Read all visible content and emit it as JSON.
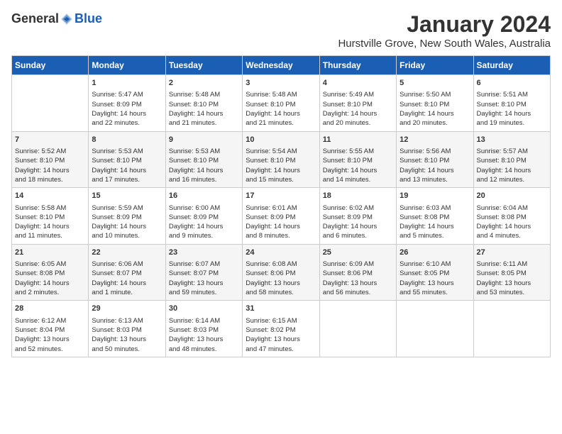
{
  "header": {
    "logo_general": "General",
    "logo_blue": "Blue",
    "title": "January 2024",
    "subtitle": "Hurstville Grove, New South Wales, Australia"
  },
  "columns": [
    "Sunday",
    "Monday",
    "Tuesday",
    "Wednesday",
    "Thursday",
    "Friday",
    "Saturday"
  ],
  "weeks": [
    [
      {
        "day": "",
        "info": ""
      },
      {
        "day": "1",
        "info": "Sunrise: 5:47 AM\nSunset: 8:09 PM\nDaylight: 14 hours\nand 22 minutes."
      },
      {
        "day": "2",
        "info": "Sunrise: 5:48 AM\nSunset: 8:10 PM\nDaylight: 14 hours\nand 21 minutes."
      },
      {
        "day": "3",
        "info": "Sunrise: 5:48 AM\nSunset: 8:10 PM\nDaylight: 14 hours\nand 21 minutes."
      },
      {
        "day": "4",
        "info": "Sunrise: 5:49 AM\nSunset: 8:10 PM\nDaylight: 14 hours\nand 20 minutes."
      },
      {
        "day": "5",
        "info": "Sunrise: 5:50 AM\nSunset: 8:10 PM\nDaylight: 14 hours\nand 20 minutes."
      },
      {
        "day": "6",
        "info": "Sunrise: 5:51 AM\nSunset: 8:10 PM\nDaylight: 14 hours\nand 19 minutes."
      }
    ],
    [
      {
        "day": "7",
        "info": "Sunrise: 5:52 AM\nSunset: 8:10 PM\nDaylight: 14 hours\nand 18 minutes."
      },
      {
        "day": "8",
        "info": "Sunrise: 5:53 AM\nSunset: 8:10 PM\nDaylight: 14 hours\nand 17 minutes."
      },
      {
        "day": "9",
        "info": "Sunrise: 5:53 AM\nSunset: 8:10 PM\nDaylight: 14 hours\nand 16 minutes."
      },
      {
        "day": "10",
        "info": "Sunrise: 5:54 AM\nSunset: 8:10 PM\nDaylight: 14 hours\nand 15 minutes."
      },
      {
        "day": "11",
        "info": "Sunrise: 5:55 AM\nSunset: 8:10 PM\nDaylight: 14 hours\nand 14 minutes."
      },
      {
        "day": "12",
        "info": "Sunrise: 5:56 AM\nSunset: 8:10 PM\nDaylight: 14 hours\nand 13 minutes."
      },
      {
        "day": "13",
        "info": "Sunrise: 5:57 AM\nSunset: 8:10 PM\nDaylight: 14 hours\nand 12 minutes."
      }
    ],
    [
      {
        "day": "14",
        "info": "Sunrise: 5:58 AM\nSunset: 8:10 PM\nDaylight: 14 hours\nand 11 minutes."
      },
      {
        "day": "15",
        "info": "Sunrise: 5:59 AM\nSunset: 8:09 PM\nDaylight: 14 hours\nand 10 minutes."
      },
      {
        "day": "16",
        "info": "Sunrise: 6:00 AM\nSunset: 8:09 PM\nDaylight: 14 hours\nand 9 minutes."
      },
      {
        "day": "17",
        "info": "Sunrise: 6:01 AM\nSunset: 8:09 PM\nDaylight: 14 hours\nand 8 minutes."
      },
      {
        "day": "18",
        "info": "Sunrise: 6:02 AM\nSunset: 8:09 PM\nDaylight: 14 hours\nand 6 minutes."
      },
      {
        "day": "19",
        "info": "Sunrise: 6:03 AM\nSunset: 8:08 PM\nDaylight: 14 hours\nand 5 minutes."
      },
      {
        "day": "20",
        "info": "Sunrise: 6:04 AM\nSunset: 8:08 PM\nDaylight: 14 hours\nand 4 minutes."
      }
    ],
    [
      {
        "day": "21",
        "info": "Sunrise: 6:05 AM\nSunset: 8:08 PM\nDaylight: 14 hours\nand 2 minutes."
      },
      {
        "day": "22",
        "info": "Sunrise: 6:06 AM\nSunset: 8:07 PM\nDaylight: 14 hours\nand 1 minute."
      },
      {
        "day": "23",
        "info": "Sunrise: 6:07 AM\nSunset: 8:07 PM\nDaylight: 13 hours\nand 59 minutes."
      },
      {
        "day": "24",
        "info": "Sunrise: 6:08 AM\nSunset: 8:06 PM\nDaylight: 13 hours\nand 58 minutes."
      },
      {
        "day": "25",
        "info": "Sunrise: 6:09 AM\nSunset: 8:06 PM\nDaylight: 13 hours\nand 56 minutes."
      },
      {
        "day": "26",
        "info": "Sunrise: 6:10 AM\nSunset: 8:05 PM\nDaylight: 13 hours\nand 55 minutes."
      },
      {
        "day": "27",
        "info": "Sunrise: 6:11 AM\nSunset: 8:05 PM\nDaylight: 13 hours\nand 53 minutes."
      }
    ],
    [
      {
        "day": "28",
        "info": "Sunrise: 6:12 AM\nSunset: 8:04 PM\nDaylight: 13 hours\nand 52 minutes."
      },
      {
        "day": "29",
        "info": "Sunrise: 6:13 AM\nSunset: 8:03 PM\nDaylight: 13 hours\nand 50 minutes."
      },
      {
        "day": "30",
        "info": "Sunrise: 6:14 AM\nSunset: 8:03 PM\nDaylight: 13 hours\nand 48 minutes."
      },
      {
        "day": "31",
        "info": "Sunrise: 6:15 AM\nSunset: 8:02 PM\nDaylight: 13 hours\nand 47 minutes."
      },
      {
        "day": "",
        "info": ""
      },
      {
        "day": "",
        "info": ""
      },
      {
        "day": "",
        "info": ""
      }
    ]
  ]
}
